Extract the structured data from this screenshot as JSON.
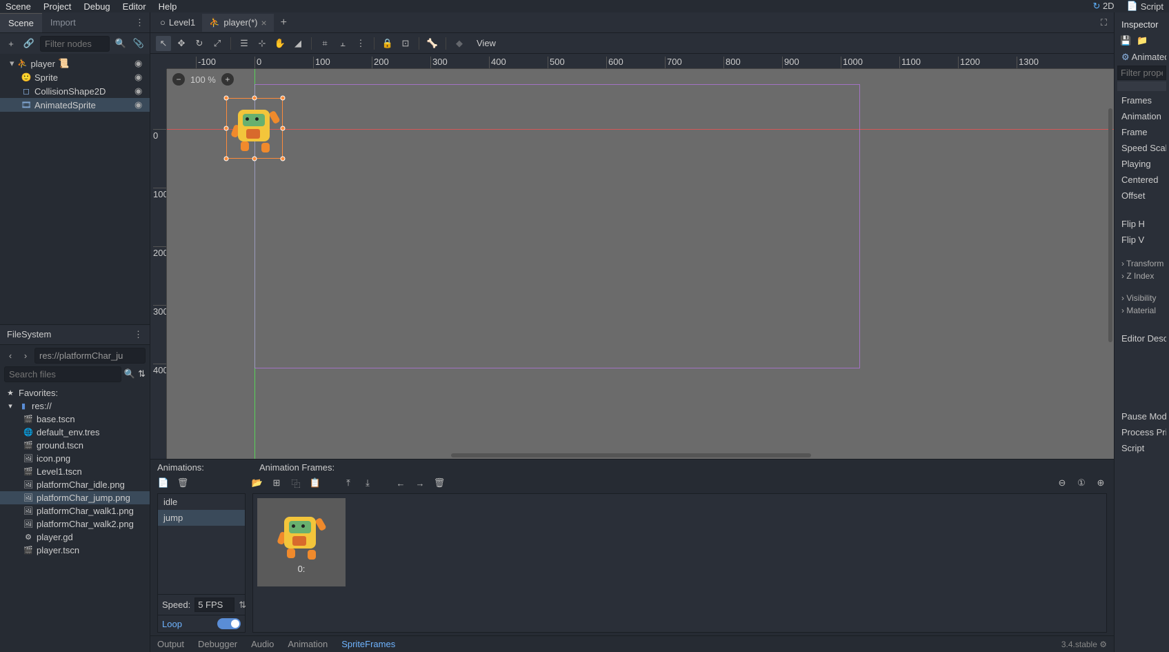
{
  "menubar": {
    "items": [
      "Scene",
      "Project",
      "Debug",
      "Editor",
      "Help"
    ],
    "mode2d": "2D",
    "script": "Script"
  },
  "scene_panel": {
    "tabs": [
      "Scene",
      "Import"
    ],
    "active_tab": 0,
    "filter_placeholder": "Filter nodes",
    "nodes": [
      {
        "name": "player",
        "icon": "kinematic",
        "depth": 0,
        "script": true,
        "visible": true,
        "selected": false,
        "collapsed": false
      },
      {
        "name": "Sprite",
        "icon": "sprite",
        "depth": 1,
        "script": false,
        "visible": true,
        "selected": false
      },
      {
        "name": "CollisionShape2D",
        "icon": "collision",
        "depth": 1,
        "script": false,
        "visible": true,
        "selected": false
      },
      {
        "name": "AnimatedSprite",
        "icon": "animsprite",
        "depth": 1,
        "script": false,
        "visible": true,
        "selected": true
      }
    ]
  },
  "filesystem": {
    "title": "FileSystem",
    "path_value": "res://platformChar_ju",
    "search_placeholder": "Search files",
    "favorites_label": "Favorites:",
    "root_label": "res://",
    "files": [
      {
        "name": "base.tscn",
        "icon": "scene"
      },
      {
        "name": "default_env.tres",
        "icon": "env"
      },
      {
        "name": "ground.tscn",
        "icon": "scene"
      },
      {
        "name": "icon.png",
        "icon": "image"
      },
      {
        "name": "Level1.tscn",
        "icon": "scene",
        "link": true
      },
      {
        "name": "platformChar_idle.png",
        "icon": "image"
      },
      {
        "name": "platformChar_jump.png",
        "icon": "image",
        "selected": true
      },
      {
        "name": "platformChar_walk1.png",
        "icon": "image"
      },
      {
        "name": "platformChar_walk2.png",
        "icon": "image"
      },
      {
        "name": "player.gd",
        "icon": "script"
      },
      {
        "name": "player.tscn",
        "icon": "scene"
      }
    ]
  },
  "docs": {
    "tabs": [
      {
        "label": "Level1",
        "active": false,
        "icon": "circle"
      },
      {
        "label": "player(*)",
        "active": true,
        "icon": "kinematic"
      }
    ]
  },
  "editor_toolbar": {
    "view_label": "View"
  },
  "viewport": {
    "zoom": "100 %",
    "ruler_h": [
      "-100",
      "0",
      "100",
      "200",
      "300",
      "400",
      "500",
      "600",
      "700",
      "800",
      "900",
      "1000",
      "1100",
      "1200",
      "1300"
    ],
    "ruler_v": [
      "0",
      "100",
      "200",
      "300",
      "400"
    ]
  },
  "anim": {
    "col1_header": "Animations:",
    "col2_header": "Animation Frames:",
    "animations": [
      {
        "name": "idle",
        "selected": false
      },
      {
        "name": "jump",
        "selected": true
      }
    ],
    "speed_label": "Speed:",
    "speed_value": "5 FPS",
    "loop_label": "Loop",
    "loop_on": true,
    "frames": [
      {
        "label": "0:"
      }
    ]
  },
  "bottom_tabs": {
    "tabs": [
      "Output",
      "Debugger",
      "Audio",
      "Animation",
      "SpriteFrames"
    ],
    "active": 4,
    "version": "3.4.stable"
  },
  "inspector": {
    "title": "Inspector",
    "node_label": "AnimatedSprite",
    "filter_placeholder": "Filter properties",
    "props": [
      "Frames",
      "Animation",
      "Frame",
      "Speed Scale",
      "Playing",
      "Centered",
      "Offset",
      "Flip H",
      "Flip V"
    ],
    "groups": [
      "Transform",
      "Z Index",
      "Visibility",
      "Material"
    ],
    "editor_desc": "Editor Description",
    "pause_mode": "Pause Mode",
    "process": "Process Priority",
    "script": "Script"
  }
}
